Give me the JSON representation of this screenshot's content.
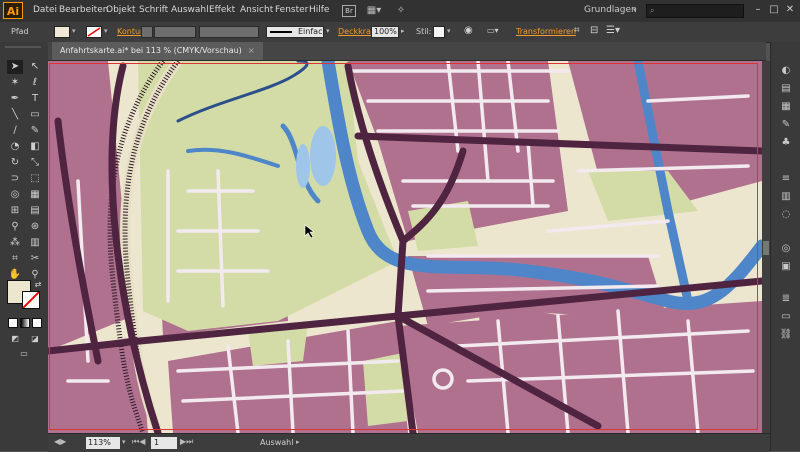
{
  "app": {
    "logo": "Ai"
  },
  "menu": [
    "Datei",
    "Bearbeiten",
    "Objekt",
    "Schrift",
    "Auswahl",
    "Effekt",
    "Ansicht",
    "Fenster",
    "Hilfe"
  ],
  "bridge": "Br",
  "workspace": "Grundlagen",
  "window": {
    "minimize": "–",
    "maximize": "□",
    "close": "✕"
  },
  "control": {
    "object_type": "Pfad",
    "stroke_label": "Kontur:",
    "stroke_style": "Einfach",
    "opacity_label": "Deckkraft",
    "opacity_value": "100%",
    "style_label": "Stil:",
    "transform_label": "Transformieren"
  },
  "document": {
    "tab_title": "Anfahrtskarte.ai* bei 113 % (CMYK/Vorschau)",
    "close": "×"
  },
  "status": {
    "zoom": "113%",
    "page": "1",
    "tool": "Auswahl"
  },
  "colors": {
    "urban": "#b0718f",
    "park": "#d3dca6",
    "water": "#4e86c9",
    "road": "#4f2440",
    "background": "#ede6cf",
    "accent": "#f59b2c"
  },
  "icons": {
    "tools": [
      "selection-icon",
      "direct-selection-icon",
      "magic-wand-icon",
      "lasso-icon",
      "pen-icon",
      "type-icon",
      "line-icon",
      "rectangle-icon",
      "brush-icon",
      "pencil-icon",
      "blob-brush-icon",
      "eraser-icon",
      "rotate-icon",
      "scale-icon",
      "width-icon",
      "free-transform-icon",
      "shape-builder-icon",
      "perspective-icon",
      "mesh-icon",
      "gradient-icon",
      "eyedropper-icon",
      "blend-icon",
      "symbol-sprayer-icon",
      "graph-icon",
      "artboard-icon",
      "slice-icon",
      "hand-icon",
      "zoom-icon"
    ],
    "panels": [
      "color-icon",
      "color-guide-icon",
      "swatches-icon",
      "brushes-icon",
      "symbols-icon",
      "stroke-icon",
      "gradient-panel-icon",
      "transparency-icon",
      "appearance-icon",
      "graphic-styles-icon",
      "layers-icon",
      "artboards-icon",
      "links-icon"
    ]
  }
}
